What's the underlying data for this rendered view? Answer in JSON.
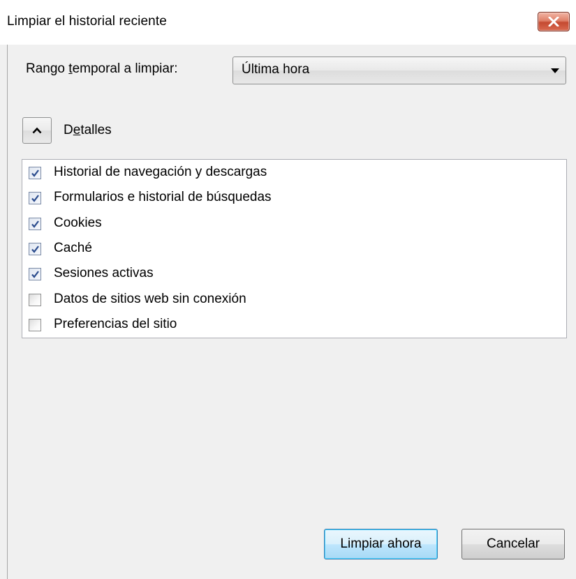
{
  "window": {
    "title": "Limpiar el historial reciente"
  },
  "range": {
    "label_prefix": "Rango ",
    "label_accel": "t",
    "label_suffix": "emporal a limpiar:",
    "selected": "Última hora"
  },
  "details": {
    "label_prefix": "D",
    "label_accel": "e",
    "label_suffix": "talles",
    "expanded": true
  },
  "items": [
    {
      "label": "Historial de navegación y descargas",
      "checked": true
    },
    {
      "label": "Formularios e historial de búsquedas",
      "checked": true
    },
    {
      "label": "Cookies",
      "checked": true
    },
    {
      "label": "Caché",
      "checked": true
    },
    {
      "label": "Sesiones activas",
      "checked": true
    },
    {
      "label": "Datos de sitios web sin conexión",
      "checked": false
    },
    {
      "label": "Preferencias del sitio",
      "checked": false
    }
  ],
  "buttons": {
    "clear_now": "Limpiar ahora",
    "cancel": "Cancelar"
  },
  "colors": {
    "dialog_bg": "#f0f0f0",
    "close_button": "#c54a31",
    "check_mark": "#2a4b8d",
    "primary_button_border": "#3c7fb1"
  },
  "icons": {
    "close": "close-icon",
    "collapse": "chevron-up-icon",
    "dropdown": "chevron-down-icon",
    "check": "check-icon"
  }
}
